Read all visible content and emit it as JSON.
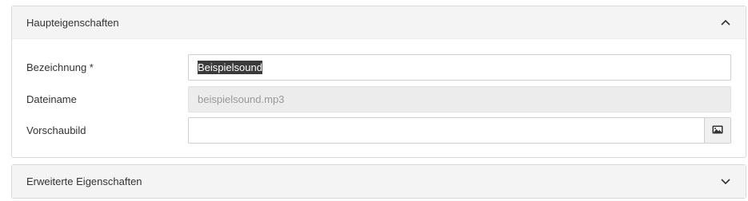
{
  "main_panel": {
    "title": "Haupteigenschaften",
    "toggle_icon": "chevron-up-icon",
    "fields": {
      "bezeichnung": {
        "label": "Bezeichnung *",
        "value": "Beispielsound"
      },
      "dateiname": {
        "label": "Dateiname",
        "value": "beispielsound.mp3"
      },
      "vorschaubild": {
        "label": "Vorschaubild",
        "value": "",
        "button_icon": "image-icon"
      }
    }
  },
  "extended_panel": {
    "title": "Erweiterte Eigenschaften",
    "toggle_icon": "chevron-down-icon"
  },
  "colors": {
    "header_bg": "#f4f4f4",
    "border": "#d8d8d8",
    "disabled_bg": "#ececec",
    "selection_bg": "#3a3a3a"
  }
}
